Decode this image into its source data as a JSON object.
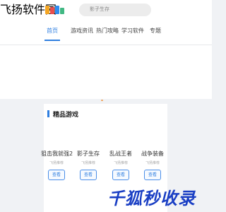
{
  "header": {
    "logo_text": "飞扬软件园",
    "search_placeholder": "影子生存"
  },
  "nav": {
    "tabs": [
      {
        "label": "首页",
        "active": true
      },
      {
        "label": "游戏资讯"
      },
      {
        "label": "热门攻略"
      },
      {
        "label": "学习软件"
      },
      {
        "label": "专题"
      }
    ]
  },
  "section": {
    "title": "精品游戏",
    "games": [
      {
        "name": "狙击我就强2",
        "sub": "飞扬推荐",
        "button": "查看"
      },
      {
        "name": "影子生存",
        "sub": "飞扬推荐",
        "button": "查看"
      },
      {
        "name": "乱战王者",
        "sub": "飞扬推荐",
        "button": "查看"
      },
      {
        "name": "战争装备",
        "sub": "飞扬推荐",
        "button": "查看"
      }
    ]
  },
  "watermark": "千狐秒收录"
}
